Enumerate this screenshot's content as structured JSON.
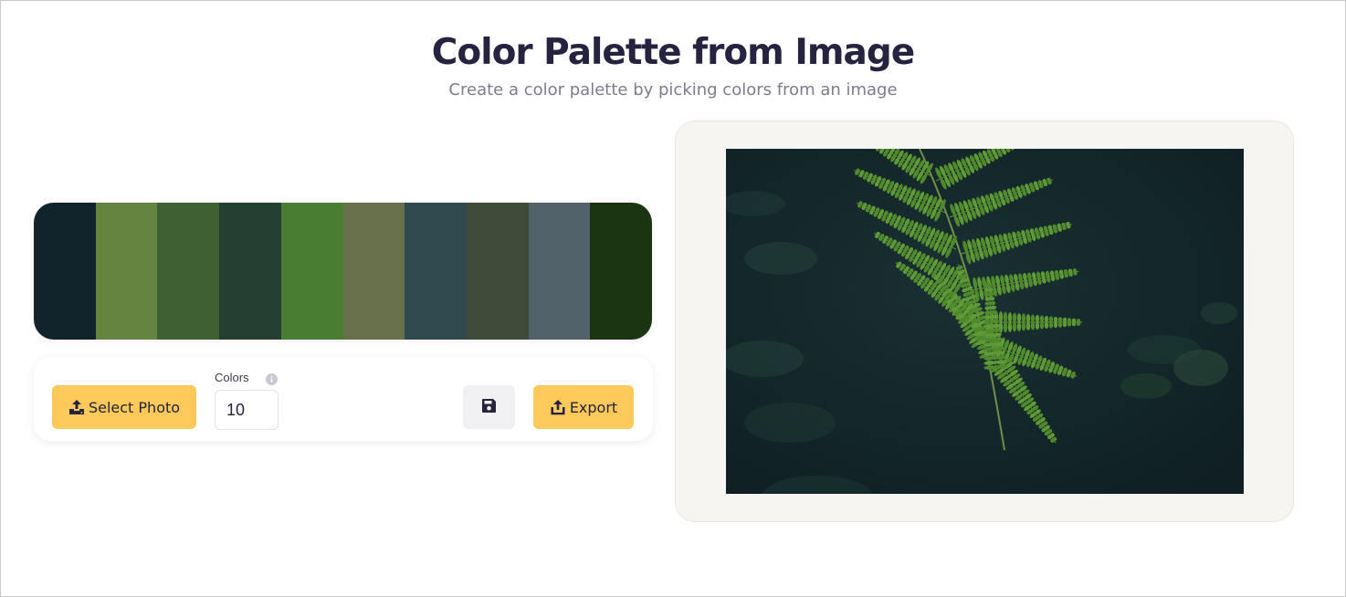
{
  "header": {
    "title": "Color Palette from Image",
    "subtitle": "Create a color palette by picking colors from an image"
  },
  "palette": {
    "colors": [
      "#12242b",
      "#658440",
      "#3e6133",
      "#253f33",
      "#497d31",
      "#67704a",
      "#304a4f",
      "#3e4b38",
      "#52626b",
      "#1b3512"
    ]
  },
  "controls": {
    "select_photo_label": "Select Photo",
    "colors_label": "Colors",
    "colors_value": "10",
    "export_label": "Export",
    "icons": {
      "select_photo": "upload-tray-icon",
      "info": "info-icon",
      "save": "floppy-disk-icon",
      "export": "share-upload-icon"
    }
  },
  "image": {
    "description_icon": "fern-photo",
    "accent_color": "#fdc95a"
  }
}
